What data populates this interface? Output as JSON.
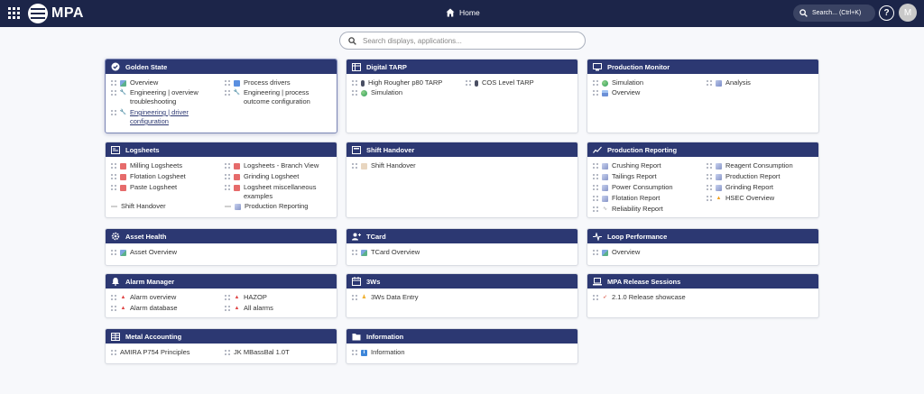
{
  "app": {
    "title": "MPA",
    "home_label": "Home",
    "search_label": "Search... (Ctrl+K)",
    "help_label": "?",
    "avatar_initial": "M"
  },
  "search": {
    "placeholder": "Search displays, applications..."
  },
  "cards": {
    "golden_state": {
      "title": "Golden State",
      "items": [
        "Overview",
        "Process drivers",
        "Engineering | overview troubleshooting",
        "Engineering | process outcome configuration",
        "Engineering | driver configuration"
      ]
    },
    "digital_tarp": {
      "title": "Digital TARP",
      "items": [
        "High Rougher p80 TARP",
        "COS Level TARP",
        "Simulation"
      ]
    },
    "production_monitor": {
      "title": "Production Monitor",
      "items": [
        "Simulation",
        "Analysis",
        "Overview"
      ]
    },
    "logsheets": {
      "title": "Logsheets",
      "items": [
        "Milling Logsheets",
        "Logsheets - Branch View",
        "Flotation Logsheet",
        "Grinding Logsheet",
        "Paste Logsheet",
        "Logsheet miscellaneous examples",
        "Shift Handover",
        "Production Reporting"
      ]
    },
    "shift_handover": {
      "title": "Shift Handover",
      "items": [
        "Shift Handover"
      ]
    },
    "production_reporting": {
      "title": "Production Reporting",
      "items": [
        "Crushing Report",
        "Reagent Consumption",
        "Tailings Report",
        "Production Report",
        "Power Consumption",
        "Grinding Report",
        "Flotation Report",
        "HSEC Overview",
        "Reliability Report"
      ]
    },
    "asset_health": {
      "title": "Asset Health",
      "items": [
        "Asset Overview"
      ]
    },
    "tcard": {
      "title": "TCard",
      "items": [
        "TCard Overview"
      ]
    },
    "loop_performance": {
      "title": "Loop Performance",
      "items": [
        "Overview"
      ]
    },
    "alarm_manager": {
      "title": "Alarm Manager",
      "items": [
        "Alarm overview",
        "HAZOP",
        "Alarm database",
        "All alarms"
      ]
    },
    "threews": {
      "title": "3Ws",
      "items": [
        "3Ws Data Entry"
      ]
    },
    "release_sessions": {
      "title": "MPA Release Sessions",
      "items": [
        "2.1.0 Release showcase"
      ]
    },
    "metal_accounting": {
      "title": "Metal Accounting",
      "items": [
        "AMIRA P754 Principles",
        "JK MBassBal 1.0T"
      ]
    },
    "information": {
      "title": "Information",
      "items": [
        "Information"
      ]
    }
  },
  "colors": {
    "topbar": "#1c2549",
    "card_header": "#2c3872",
    "background": "#f7f8fb"
  }
}
